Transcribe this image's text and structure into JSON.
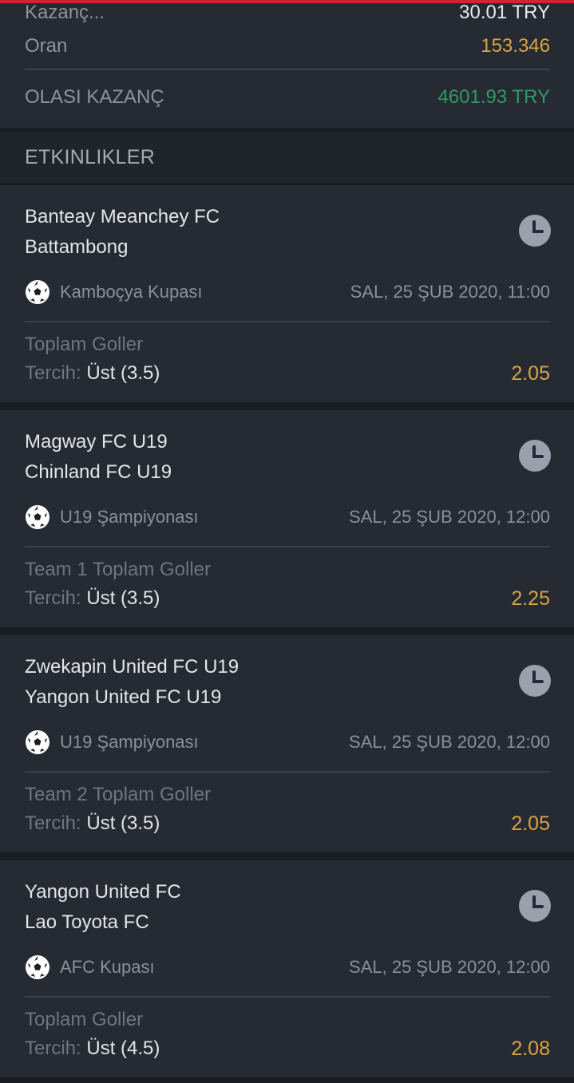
{
  "summary": {
    "win_label": "Kazanç...",
    "win_value": "30.01 TRY",
    "odds_label": "Oran",
    "odds_value": "153.346",
    "possible_label": "OLASI KAZANÇ",
    "possible_value": "4601.93 TRY"
  },
  "events_header": "ETKINLIKLER",
  "events": [
    {
      "team1": "Banteay Meanchey FC",
      "team2": "Battambong",
      "league": "Kamboçya Kupası",
      "date": "SAL, 25 ŞUB 2020, 11:00",
      "market": "Toplam Goller",
      "pref_label": "Tercih: ",
      "pref_value": "Üst (3.5)",
      "odd": "2.05"
    },
    {
      "team1": "Magway FC U19",
      "team2": "Chinland FC U19",
      "league": "U19 Şampiyonası",
      "date": "SAL, 25 ŞUB 2020, 12:00",
      "market": "Team 1 Toplam Goller",
      "pref_label": "Tercih: ",
      "pref_value": "Üst (3.5)",
      "odd": "2.25"
    },
    {
      "team1": "Zwekapin United FC U19",
      "team2": "Yangon United FC U19",
      "league": "U19 Şampiyonası",
      "date": "SAL, 25 ŞUB 2020, 12:00",
      "market": "Team 2 Toplam Goller",
      "pref_label": "Tercih: ",
      "pref_value": "Üst (3.5)",
      "odd": "2.05"
    },
    {
      "team1": "Yangon United FC",
      "team2": "Lao Toyota FC",
      "league": "AFC Kupası",
      "date": "SAL, 25 ŞUB 2020, 12:00",
      "market": "Toplam Goller",
      "pref_label": "Tercih: ",
      "pref_value": "Üst (4.5)",
      "odd": "2.08"
    }
  ],
  "icons": {
    "clock": "clock-icon",
    "sport": "soccer-ball-icon"
  },
  "colors": {
    "accent_red": "#d4252e",
    "odds_gold": "#d9a440",
    "win_green": "#2f9a66"
  }
}
